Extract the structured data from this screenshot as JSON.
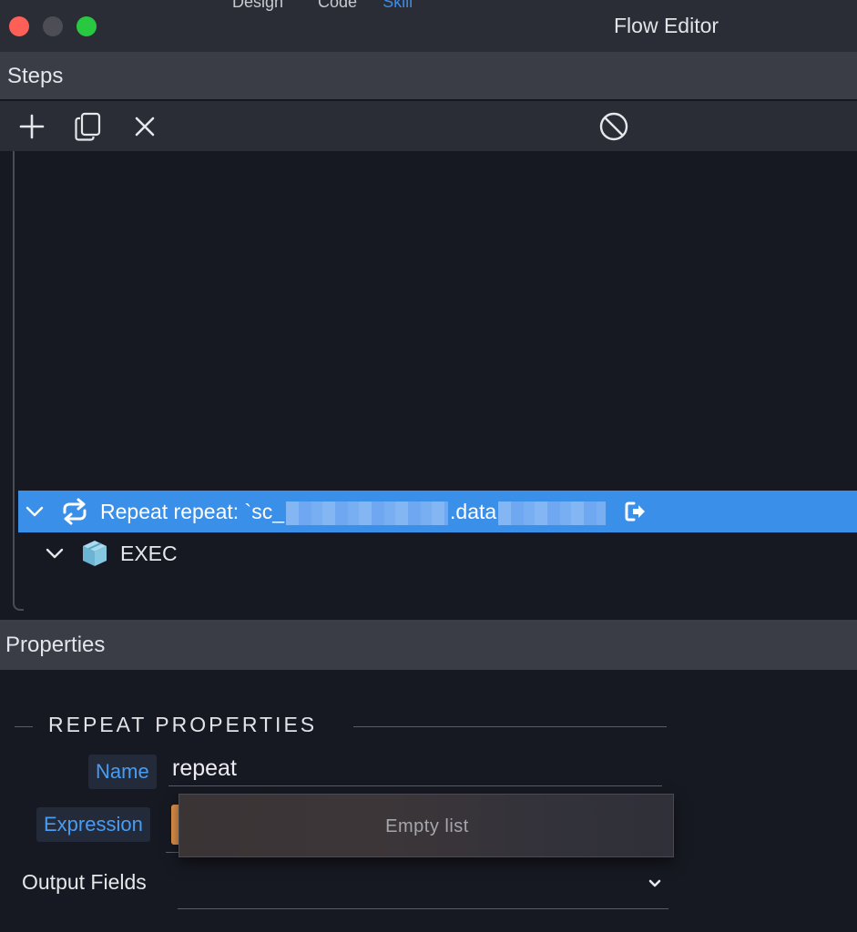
{
  "window": {
    "title": "Flow Editor",
    "bleed_through": [
      "Design",
      "Code",
      "Skill"
    ]
  },
  "steps": {
    "header": "Steps",
    "toolbar": {
      "add": "plus-icon",
      "copy": "copy-icon",
      "delete": "close-icon",
      "disable": "ban-icon"
    },
    "tree": [
      {
        "type": "repeat",
        "label_prefix": "Repeat repeat: `sc_",
        "label_middle": ".data",
        "selected": true,
        "icon": "loop-icon"
      },
      {
        "type": "exec",
        "label": "EXEC",
        "icon": "cube-icon"
      }
    ]
  },
  "properties": {
    "header": "Properties",
    "legend": "REPEAT PROPERTIES",
    "name_label": "Name",
    "name_value": "repeat",
    "expression_label": "Expression",
    "expression_popup": "Empty list",
    "output_fields_label": "Output Fields"
  },
  "colors": {
    "selection": "#3a8fe8",
    "label_blue": "#4a9cf2",
    "accent_orange": "#e0924a",
    "background": "#171922",
    "header": "#3a3c46"
  }
}
